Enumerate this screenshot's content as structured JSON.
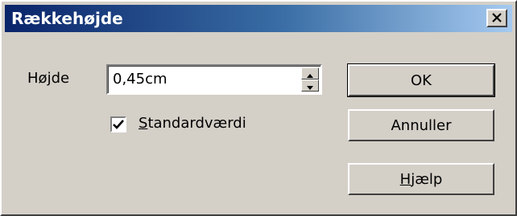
{
  "window": {
    "title": "Rækkehøjde",
    "close_icon": "close-icon"
  },
  "height": {
    "label_pre": "Hø",
    "label_mnemonic": "j",
    "label_post": "de",
    "value": "0,45cm"
  },
  "default_checkbox": {
    "checked": true,
    "label_mnemonic": "S",
    "label_rest": "tandardværdi"
  },
  "buttons": {
    "ok": "OK",
    "cancel": "Annuller",
    "help_mnemonic": "H",
    "help_rest": "jælp"
  },
  "colors": {
    "titlebar_start": "#0a246a",
    "titlebar_end": "#a6caf0",
    "face": "#d4d0c8"
  }
}
